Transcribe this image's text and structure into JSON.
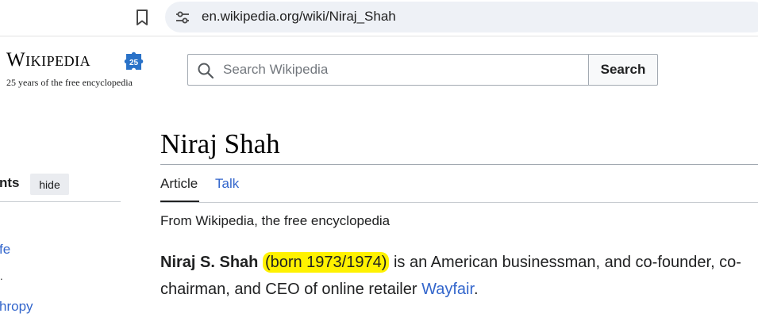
{
  "browser": {
    "url": "en.wikipedia.org/wiki/Niraj_Shah",
    "icons": [
      "bookmark-icon",
      "tune-icon"
    ]
  },
  "header": {
    "wordmark": "Wikipedia",
    "anniversary_badge": "25",
    "tagline": "25 years of the free encyclopedia",
    "search_placeholder": "Search Wikipedia",
    "search_button": "Search"
  },
  "sidebar": {
    "toc_title": "nts",
    "hide_label": "hide",
    "items": [
      {
        "label": "fe"
      },
      {
        "label": "hropy"
      }
    ],
    "mark": "."
  },
  "article": {
    "title": "Niraj Shah",
    "tabs": [
      {
        "label": "Article",
        "active": true
      },
      {
        "label": "Talk",
        "active": false
      }
    ],
    "site_sub": "From Wikipedia, the free encyclopedia",
    "lead": {
      "name": "Niraj S. Shah",
      "highlighted": "(born 1973/1974)",
      "middle": " is an American businessman, and co-founder, co-chairman, and CEO of online retailer ",
      "link": "Wayfair",
      "end": "."
    }
  },
  "colors": {
    "link": "#3366cc",
    "highlight": "#fff200",
    "address_bar": "#eef1f6"
  }
}
